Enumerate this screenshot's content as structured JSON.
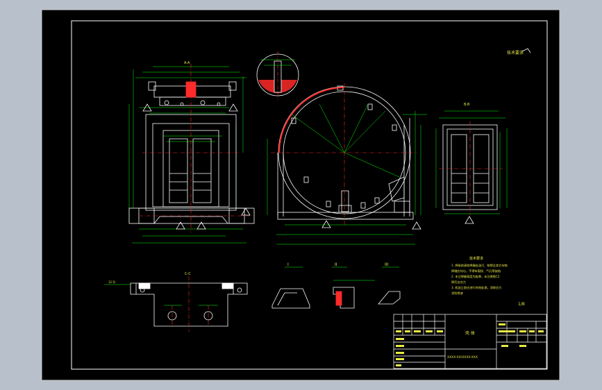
{
  "colors": {
    "app_background": "#b8c0cb",
    "paper": "#000000",
    "frame": "#ffffff",
    "geometry": "#ffffff",
    "dimension": "#00ff00",
    "centerline": "#ff2a2a",
    "notes": "#e8e84a",
    "hatch": "#ff2a2a"
  },
  "drawing": {
    "scale_note": "比例",
    "top_right_mark": "技术要求",
    "section_label_left": "A-A",
    "section_label_right": "B-B",
    "section_label_bottom": "C-C",
    "surface_roughness": "12.5/",
    "detail_a": "I",
    "detail_b": "II",
    "detail_c": "III"
  },
  "notes": {
    "title": "技术要求",
    "lines": [
      "1. 焊接前清除焊缝处油污、铁锈及其它杂物",
      "   焊缝应均匀，不得有裂纹、气孔等缺陷",
      "2. 未注焊缝高度为板厚，未注倒角C2",
      "   焊后去应力",
      "3. 机加工前应进行时效处理，消除应力",
      "   涂防锈漆"
    ]
  },
  "title_block": {
    "part_name": "壳 体",
    "drawing_code": "XXXX-XX/XXXX-XXX",
    "sheet_label": "1/8"
  }
}
